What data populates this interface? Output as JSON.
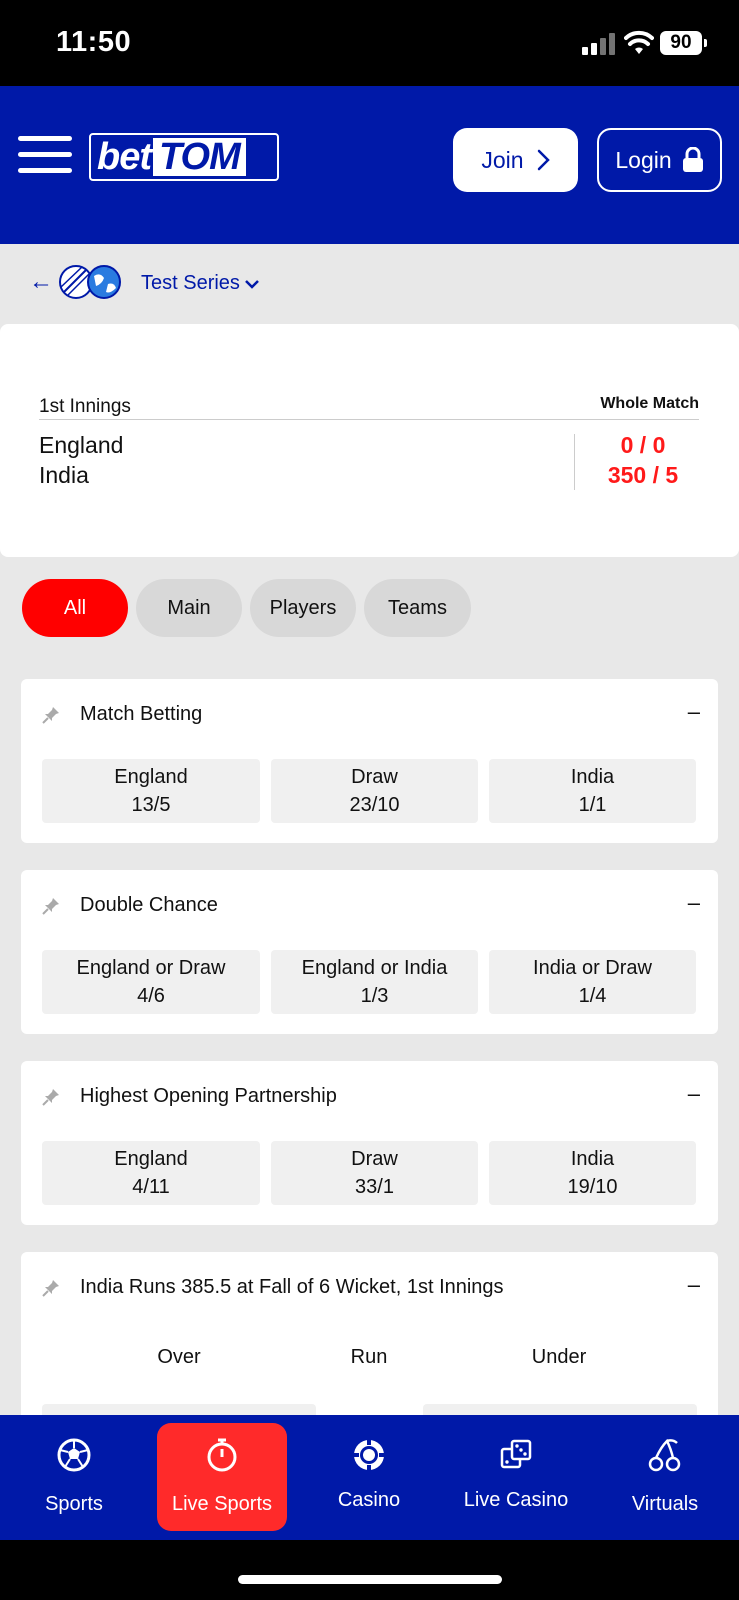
{
  "status_bar": {
    "time": "11:50",
    "battery": "90"
  },
  "header": {
    "logo_bet": "bet",
    "logo_tom": "TOM",
    "join_label": "Join",
    "login_label": "Login"
  },
  "breadcrumb": {
    "title": "Test Series"
  },
  "scoreboard": {
    "innings_label": "1st Innings",
    "column_label": "Whole Match",
    "teams": [
      {
        "name": "England",
        "score": "0 / 0"
      },
      {
        "name": "India",
        "score": "350 / 5"
      }
    ]
  },
  "filters": {
    "items": [
      "All",
      "Main",
      "Players",
      "Teams"
    ],
    "active": "All"
  },
  "markets": [
    {
      "title": "Match Betting",
      "collapse": "–",
      "outcomes": [
        {
          "label": "England",
          "odds": "13/5"
        },
        {
          "label": "Draw",
          "odds": "23/10"
        },
        {
          "label": "India",
          "odds": "1/1"
        }
      ]
    },
    {
      "title": "Double Chance",
      "collapse": "–",
      "outcomes": [
        {
          "label": "England or Draw",
          "odds": "4/6"
        },
        {
          "label": "England or India",
          "odds": "1/3"
        },
        {
          "label": "India or Draw",
          "odds": "1/4"
        }
      ]
    },
    {
      "title": "Highest Opening Partnership",
      "collapse": "–",
      "outcomes": [
        {
          "label": "England",
          "odds": "4/11"
        },
        {
          "label": "Draw",
          "odds": "33/1"
        },
        {
          "label": "India",
          "odds": "19/10"
        }
      ]
    },
    {
      "title": "India Runs 385.5 at Fall of 6 Wicket, 1st Innings",
      "collapse": "–",
      "columns": [
        "Over",
        "Run",
        "Under"
      ]
    }
  ],
  "bottom_nav": {
    "items": [
      "Sports",
      "Live Sports",
      "Casino",
      "Live Casino",
      "Virtuals"
    ],
    "active": "Live Sports"
  },
  "colors": {
    "brand_blue": "#0019a8",
    "accent_red": "#ff0000"
  }
}
